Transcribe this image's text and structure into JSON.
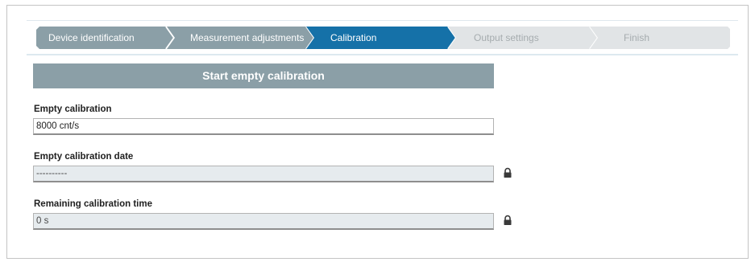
{
  "stepper": {
    "steps": [
      {
        "label": "Device identification",
        "state": "done"
      },
      {
        "label": "Measurement adjustments",
        "state": "done"
      },
      {
        "label": "Calibration",
        "state": "active"
      },
      {
        "label": "Output settings",
        "state": "pending"
      },
      {
        "label": "Finish",
        "state": "pending"
      }
    ],
    "colors": {
      "done": "#8b9fa7",
      "active": "#1571a8",
      "pending": "#e1e4e6",
      "pending_text": "#a6acaf"
    }
  },
  "section": {
    "button_label": "Start empty calibration"
  },
  "fields": {
    "empty_calibration": {
      "label": "Empty calibration",
      "value": "8000 cnt/s",
      "readonly": false
    },
    "empty_calibration_date": {
      "label": "Empty calibration date",
      "value": "----------",
      "readonly": true,
      "icon": "lock-icon"
    },
    "remaining_calibration_time": {
      "label": "Remaining calibration time",
      "value": "0 s",
      "readonly": true,
      "icon": "lock-icon"
    }
  }
}
